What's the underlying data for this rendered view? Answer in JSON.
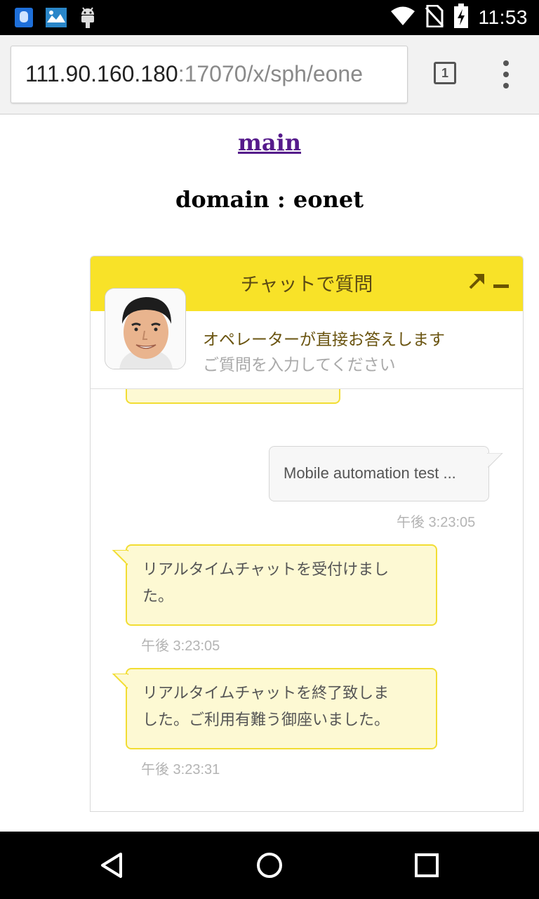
{
  "status_bar": {
    "time": "11:53",
    "icons_left": [
      "app-notification-icon",
      "photo-notification-icon",
      "android-debug-icon"
    ],
    "icons_right": [
      "wifi-icon",
      "no-sim-icon",
      "battery-charging-icon"
    ]
  },
  "browser": {
    "url_host": "111.90.160.180",
    "url_rest": ":17070/x/sph/eone",
    "tab_count": "1",
    "menu_icon": "overflow-menu-icon"
  },
  "page": {
    "link_text": "main",
    "heading": "domain : eonet"
  },
  "chat": {
    "title": "チャットで質問",
    "header_color": "#f8e228",
    "operator_line": "オペレーターが直接お答えします",
    "input_placeholder": "ご質問を入力してください",
    "messages": [
      {
        "from": "user",
        "text": "Mobile automation test ...",
        "time": "午後 3:23:05"
      },
      {
        "from": "operator",
        "text_lines": [
          "リアルタイムチャットを受付けまし",
          "た。"
        ],
        "time": "午後 3:23:05"
      },
      {
        "from": "operator",
        "text_lines": [
          "リアルタイムチャットを終了致しま",
          "した。ご利用有難う御座いました。"
        ],
        "time": "午後 3:23:31"
      }
    ]
  },
  "nav_bar": {
    "buttons": [
      "back-icon",
      "home-icon",
      "recents-icon"
    ]
  }
}
